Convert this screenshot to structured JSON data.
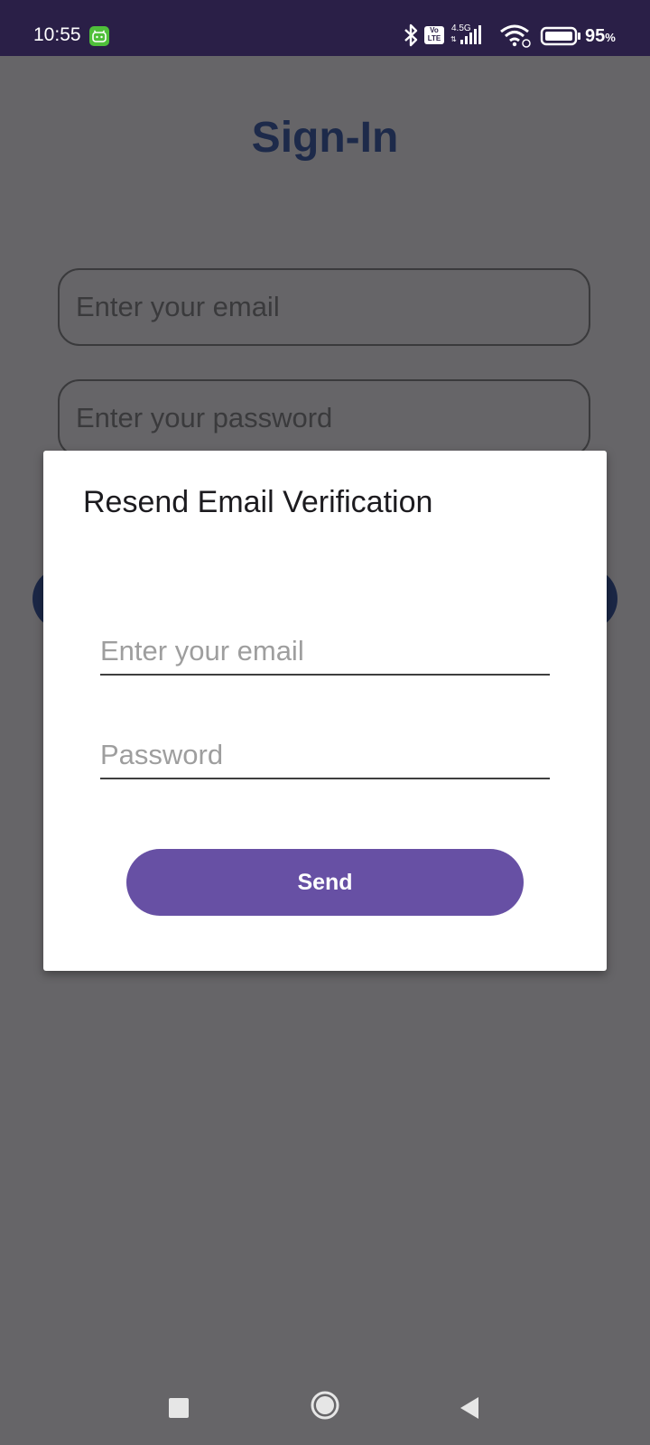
{
  "status_bar": {
    "time": "10:55",
    "network_type": "4.5G",
    "volte_label_top": "Vo",
    "volte_label_bottom": "LTE",
    "battery_percent": "95",
    "battery_unit": "%"
  },
  "background": {
    "title": "Sign-In",
    "email_placeholder": "Enter your email",
    "password_placeholder": "Enter your password"
  },
  "dialog": {
    "title": "Resend Email Verification",
    "email_placeholder": "Enter your email",
    "password_placeholder": "Password",
    "send_label": "Send"
  },
  "colors": {
    "status_bar": "#2a1f47",
    "scrim": "#666568",
    "title_text": "#1d2a4a",
    "send_button": "#6750a4"
  },
  "icons": {
    "status": [
      "bluetooth-icon",
      "volte-icon",
      "cell-signal-icon",
      "wifi-icon",
      "battery-icon"
    ],
    "nav": [
      "recents-icon",
      "home-icon",
      "back-icon"
    ]
  }
}
